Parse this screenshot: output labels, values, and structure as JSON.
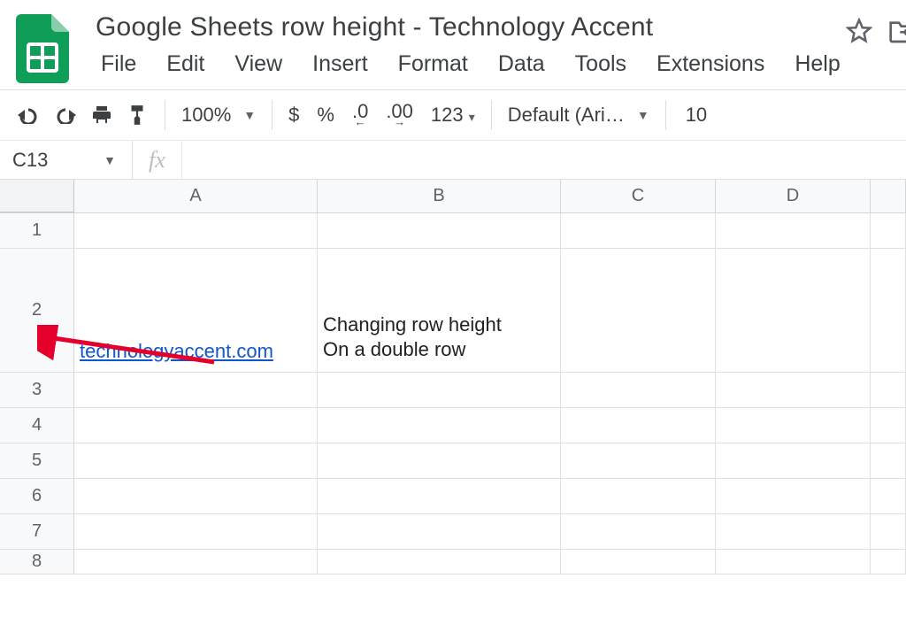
{
  "doc": {
    "title": "Google Sheets row height - Technology Accent"
  },
  "menu": {
    "file": "File",
    "edit": "Edit",
    "view": "View",
    "insert": "Insert",
    "format": "Format",
    "data": "Data",
    "tools": "Tools",
    "extensions": "Extensions",
    "help": "Help"
  },
  "toolbar": {
    "zoom": "100%",
    "currency": "$",
    "percent": "%",
    "dec_decrease": ".0",
    "dec_increase": ".00",
    "num_format": "123",
    "font": "Default (Ari…",
    "font_size": "10"
  },
  "namebox": {
    "value": "C13"
  },
  "columns": [
    "A",
    "B",
    "C",
    "D",
    ""
  ],
  "row_labels": [
    "1",
    "2",
    "3",
    "4",
    "5",
    "6",
    "7",
    "8"
  ],
  "cells": {
    "A2": "technologyaccent.com",
    "B2": "Changing row height\nOn a double row"
  }
}
